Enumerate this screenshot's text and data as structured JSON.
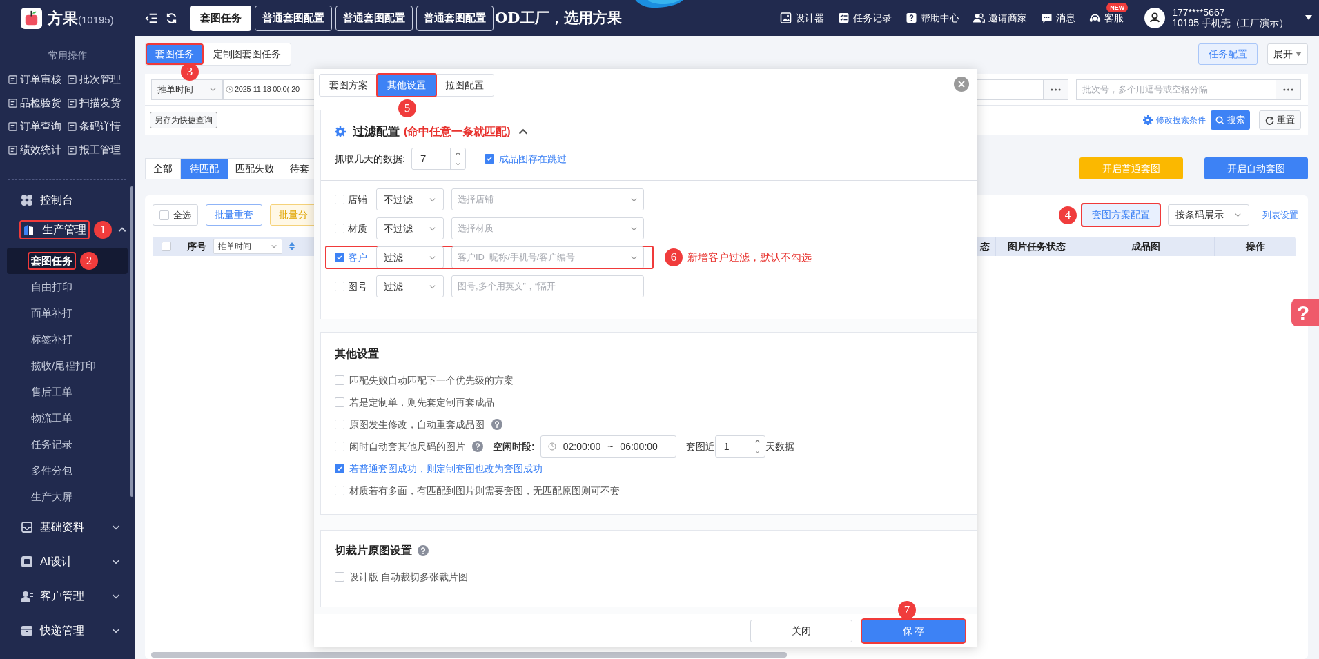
{
  "top_bar": {
    "brand": "方果",
    "brand_code": "(10195)",
    "tabs": [
      {
        "label": "套图任务",
        "selected": true
      },
      {
        "label": "普通套图配置",
        "selected": false
      },
      {
        "label": "普通套图配置",
        "selected": false
      },
      {
        "label": "普通套图配置",
        "selected": false
      }
    ],
    "banner_text": "OD工厂，选用方果",
    "links": [
      {
        "label": "设计器"
      },
      {
        "label": "任务记录"
      },
      {
        "label": "帮助中心"
      },
      {
        "label": "邀请商家"
      },
      {
        "label": "消息"
      },
      {
        "label": "客服",
        "badge": "NEW"
      }
    ],
    "user": {
      "phone": "177****5667",
      "account": "10195 手机壳（工厂演示）"
    }
  },
  "sidebar": {
    "quick_title": "常用操作",
    "quick_actions": [
      "订单审核",
      "批次管理",
      "品检验货",
      "扫描发货",
      "订单查询",
      "条码详情",
      "绩效统计",
      "报工管理"
    ],
    "menu": [
      {
        "kind": "link",
        "label": "控制台"
      },
      {
        "kind": "group",
        "label": "生产管理",
        "expanded": true,
        "marker": "1",
        "children": [
          {
            "label": "套图任务",
            "selected": true,
            "marker": "2"
          },
          {
            "label": "自由打印",
            "selected": false
          },
          {
            "label": "面单补打",
            "selected": false
          },
          {
            "label": "标签补打",
            "selected": false
          },
          {
            "label": "揽收/尾程打印",
            "selected": false
          },
          {
            "label": "售后工单",
            "selected": false
          },
          {
            "label": "物流工单",
            "selected": false
          },
          {
            "label": "任务记录",
            "selected": false
          },
          {
            "label": "多件分包",
            "selected": false
          },
          {
            "label": "生产大屏",
            "selected": false
          }
        ]
      },
      {
        "kind": "group",
        "label": "基础资料",
        "expanded": false
      },
      {
        "kind": "group",
        "label": "AI设计",
        "expanded": false
      },
      {
        "kind": "group",
        "label": "客户管理",
        "expanded": false
      },
      {
        "kind": "group",
        "label": "快递管理",
        "expanded": false
      }
    ]
  },
  "page": {
    "tabs": [
      {
        "label": "套图任务",
        "selected": true,
        "marker": "3"
      },
      {
        "label": "定制图套图任务",
        "selected": false
      }
    ],
    "task_config": "任务配置",
    "expand": "展开",
    "filters": {
      "time_field": "推单时间",
      "date_range": "2025-11-18 00:0(-20",
      "batch_placeholder": "批次号，多个用逗号或空格分隔",
      "save_query": "另存为快捷查询",
      "edit_conditions": "修改搜索条件",
      "search": "搜索",
      "reset": "重置"
    },
    "status_tabs": [
      {
        "label": "全部",
        "selected": false
      },
      {
        "label": "待匹配",
        "selected": true
      },
      {
        "label": "匹配失败",
        "selected": false
      },
      {
        "label": "待套",
        "selected": false
      }
    ],
    "actions": [
      {
        "label": "开启普通套图",
        "kind": "warning"
      },
      {
        "label": "开启自动套图",
        "kind": "primary"
      }
    ],
    "toolbar": {
      "select_all": {
        "label": "全选",
        "checked": false
      },
      "batch_buttons": [
        {
          "label": "批量重套",
          "kind": "primary"
        },
        {
          "label": "批量分",
          "kind": "warning"
        }
      ],
      "scheme_config": {
        "label": "套图方案配置",
        "marker": "4"
      },
      "display_select": "按条码展示",
      "list_settings": "列表设置"
    },
    "table": {
      "all_checked": false,
      "columns_left": [
        "序号"
      ],
      "sort_field": "推单时间",
      "columns_right": [
        "态",
        "图片任务状态",
        "成品图",
        "操作"
      ]
    },
    "help_button": "?"
  },
  "modal": {
    "tabs": [
      {
        "label": "套图方案",
        "selected": false
      },
      {
        "label": "其他设置",
        "selected": true,
        "marker": "5"
      },
      {
        "label": "拉图配置",
        "selected": false
      }
    ],
    "filter_section": {
      "title": "过滤配置",
      "note": "(命中任意一条就匹配)",
      "expanded": true,
      "days_label": "抓取几天的数据:",
      "days_value": "7",
      "skip_option": {
        "label": "成品图存在跳过",
        "checked": true
      },
      "rules": [
        {
          "label": "店铺",
          "checked": false,
          "mode": "不过滤",
          "placeholder": "选择店铺",
          "kind": "select"
        },
        {
          "label": "材质",
          "checked": false,
          "mode": "不过滤",
          "placeholder": "选择材质",
          "kind": "select"
        },
        {
          "label": "客户",
          "checked": true,
          "mode": "过滤",
          "placeholder": "客户ID_昵称/手机号/客户编号",
          "kind": "select",
          "marker": "6",
          "note": "新增客户过滤，默认不勾选"
        },
        {
          "label": "图号",
          "checked": false,
          "mode": "过滤",
          "placeholder": "图号,多个用英文”，“隔开",
          "kind": "text"
        }
      ]
    },
    "other_section": {
      "title": "其他设置",
      "options": [
        {
          "label": "匹配失败自动匹配下一个优先级的方案",
          "checked": false,
          "help": false
        },
        {
          "label": "若是定制单，则先套定制再套成品",
          "checked": false,
          "help": false
        },
        {
          "label": "原图发生修改，自动重套成品图",
          "checked": false,
          "help": true
        },
        {
          "label": "闲时自动套其他尺码的图片",
          "checked": false,
          "help": true,
          "kind": "idle"
        },
        {
          "label": "若普通套图成功，则定制套图也改为套图成功",
          "checked": true,
          "help": false
        },
        {
          "label": "材质若有多面，有匹配到图片则需要套图，无匹配原图则可不套",
          "checked": false,
          "help": false
        }
      ],
      "idle": {
        "label": "空闲时段:",
        "start": "02:00:00",
        "separator": "~",
        "end": "06:00:00",
        "recent_label": "套图近",
        "recent_value": "1",
        "recent_suffix": "天数据"
      }
    },
    "crop_section": {
      "title": "切裁片原图设置",
      "help": true,
      "options": [
        {
          "label": "设计版 自动裁切多张裁片图",
          "checked": false
        }
      ]
    },
    "footer": {
      "close": "关闭",
      "save": {
        "label": "保 存",
        "marker": "7"
      }
    }
  }
}
